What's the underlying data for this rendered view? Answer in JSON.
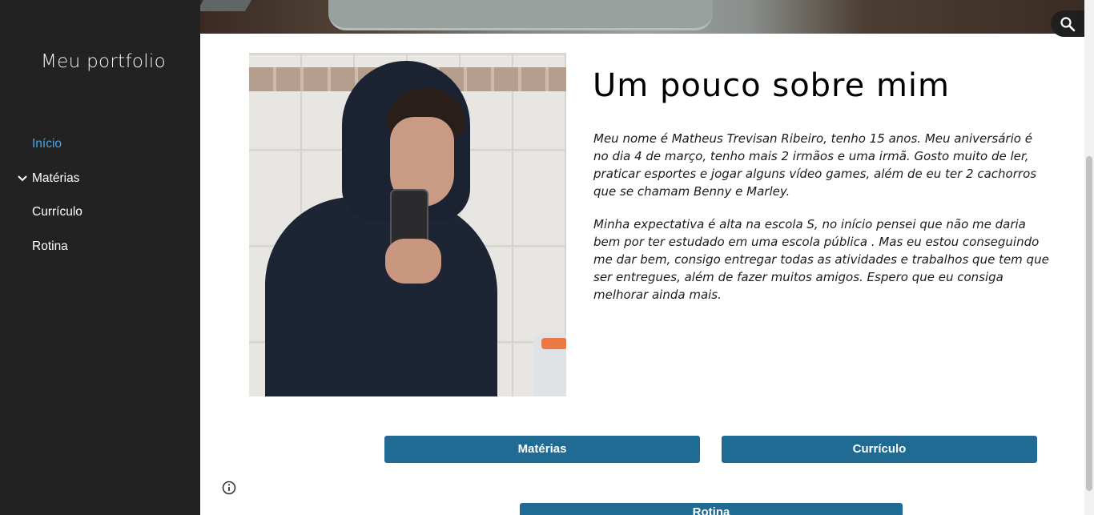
{
  "sidebar": {
    "site_title": "Meu portfolio",
    "items": [
      {
        "label": "Início",
        "active": true
      },
      {
        "label": "Matérias",
        "expandable": true
      },
      {
        "label": "Currículo"
      },
      {
        "label": "Rotina"
      }
    ]
  },
  "header": {
    "search_icon": "search-icon"
  },
  "main": {
    "heading": "Um pouco sobre mim",
    "paragraph1": "Meu nome é Matheus Trevisan Ribeiro, tenho 15 anos. Meu aniversário é no dia 4 de março, tenho mais 2 irmãos e uma irmã. Gosto muito de ler, praticar esportes e jogar alguns vídeo games, além de eu ter 2 cachorros que se chamam Benny e Marley.",
    "paragraph2": "Minha expectativa é alta na escola S, no início pensei que não me daria bem por ter estudado em uma escola pública . Mas eu estou conseguindo me dar bem, consigo entregar todas as atividades e trabalhos que tem que ser entregues, além de fazer muitos amigos. Espero que eu consiga melhorar ainda mais.",
    "buttons": {
      "materias": "Matérias",
      "curriculo": "Currículo",
      "rotina": "Rotina"
    }
  },
  "colors": {
    "sidebar_bg": "#222222",
    "active_link": "#4da6e6",
    "button_bg": "#1f6b93"
  }
}
